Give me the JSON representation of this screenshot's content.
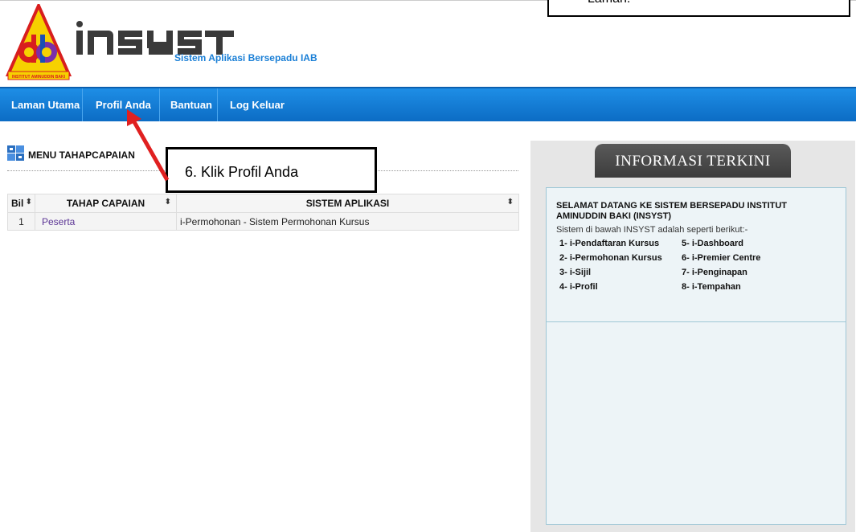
{
  "header": {
    "logo_text": "INSTITUT AMINUDDIN BAKI",
    "brand": "INSYST",
    "tagline": "Sistem Aplikasi Bersepadu IAB"
  },
  "top_note": "Laman.",
  "nav": {
    "items": [
      {
        "label": "Laman Utama"
      },
      {
        "label": "Profil Anda"
      },
      {
        "label": "Bantuan"
      },
      {
        "label": "Log Keluar"
      }
    ]
  },
  "menu": {
    "title": "MENU TAHAPCAPAIAN"
  },
  "table": {
    "headers": [
      "Bil",
      "TAHAP CAPAIAN",
      "SISTEM APLIKASI"
    ],
    "rows": [
      {
        "bil": "1",
        "tahap": "Peserta",
        "sistem": "i-Permohonan - Sistem Permohonan Kursus"
      }
    ]
  },
  "panel": {
    "tab_title": "INFORMASI TERKINI",
    "title": "SELAMAT DATANG KE SISTEM BERSEPADU INSTITUT AMINUDDIN BAKI (INSYST)",
    "subtitle": "Sistem di bawah INSYST adalah seperti berikut:-",
    "list": [
      [
        "1- i-Pendaftaran Kursus",
        "5- i-Dashboard"
      ],
      [
        "2- i-Permohonan Kursus",
        "6- i-Premier Centre"
      ],
      [
        "3- i-Sijil",
        "7- i-Penginapan"
      ],
      [
        "4- i-Profil",
        "8- i-Tempahan"
      ]
    ]
  },
  "annotation": {
    "text": "6. Klik Profil Anda"
  },
  "colors": {
    "nav": "#1380db",
    "link": "#5c3595",
    "tagline": "#1a7fd6",
    "arrow": "#e02020"
  }
}
